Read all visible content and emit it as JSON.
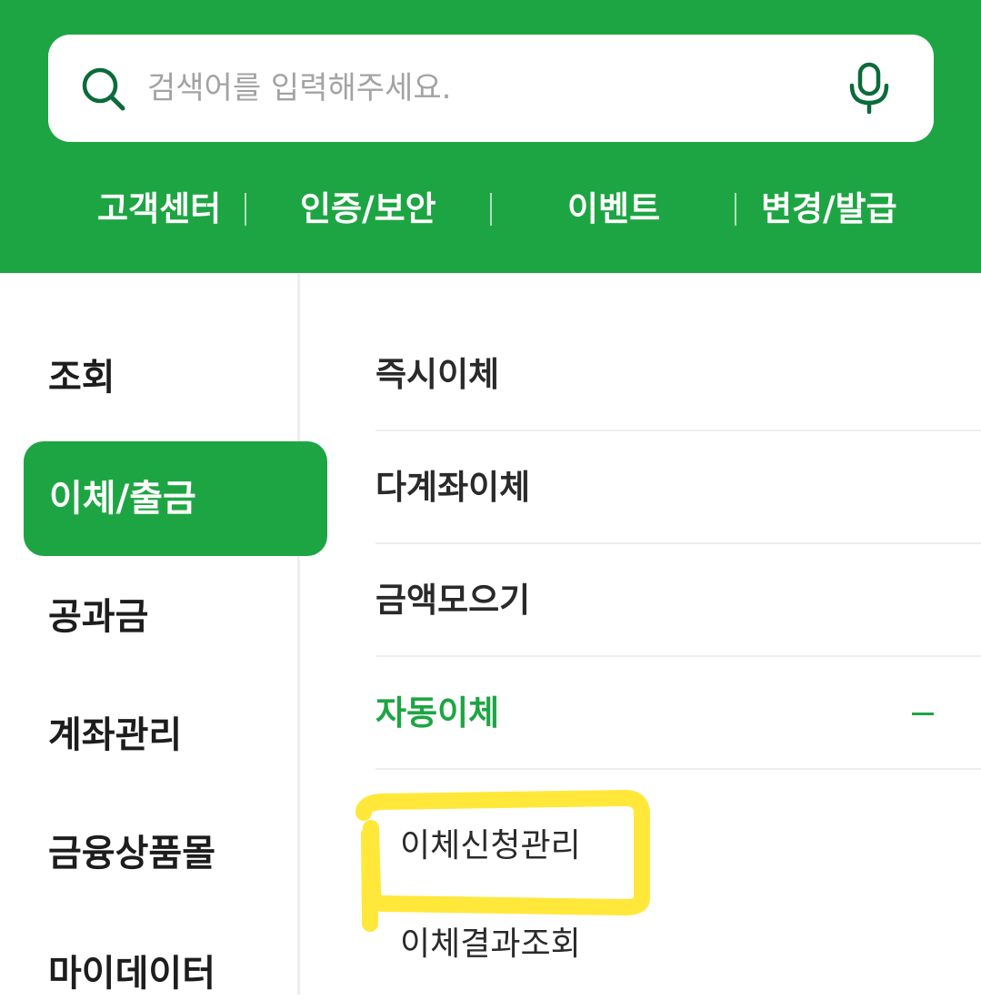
{
  "search": {
    "placeholder": "검색어를 입력해주세요.",
    "icon": "search-icon",
    "mic_icon": "microphone-icon"
  },
  "quick_links": [
    "고객센터",
    "인증/보안",
    "이벤트",
    "변경/발급"
  ],
  "sidebar": {
    "items": [
      "조회",
      "이체/출금",
      "공과금",
      "계좌관리",
      "금융상품몰",
      "마이데이터"
    ],
    "active_index": 1
  },
  "menu": {
    "items": [
      "즉시이체",
      "다계좌이체",
      "금액모으기",
      "자동이체"
    ],
    "expanded_index": 3,
    "subitems": [
      "이체신청관리",
      "이체결과조회"
    ]
  },
  "colors": {
    "brand_green": "#1ea543",
    "dark_green_icon": "#0b6b3a",
    "highlight_yellow": "#ffe83a"
  }
}
